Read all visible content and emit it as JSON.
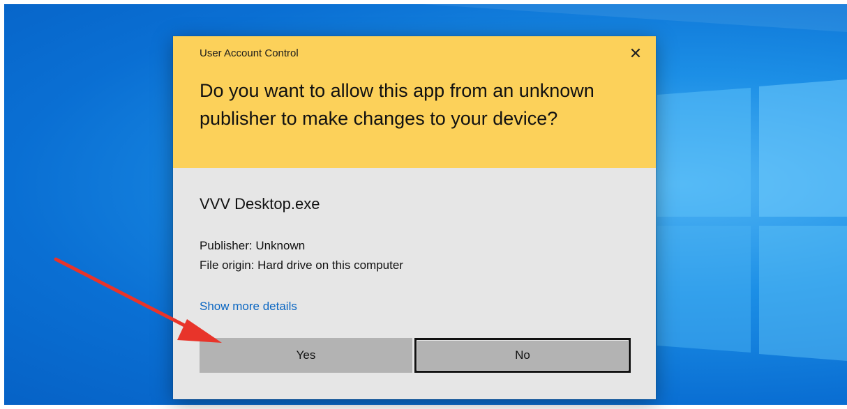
{
  "dialog": {
    "title": "User Account Control",
    "question": "Do you want to allow this app from an unknown publisher to make changes to your device?",
    "app_name": "VVV Desktop.exe",
    "publisher": "Publisher: Unknown",
    "file_origin": "File origin: Hard drive on this computer",
    "details_link": "Show more details",
    "yes_label": "Yes",
    "no_label": "No",
    "close_icon": "close-icon"
  },
  "colors": {
    "header": "#fcd15a",
    "body": "#e6e6e6",
    "button": "#b3b3b3",
    "link": "#0a66c2",
    "annotation_arrow": "#e8342a",
    "desktop": "#1c8fe6"
  },
  "annotation": {
    "icon": "red-arrow-pointing-to-yes-button"
  }
}
